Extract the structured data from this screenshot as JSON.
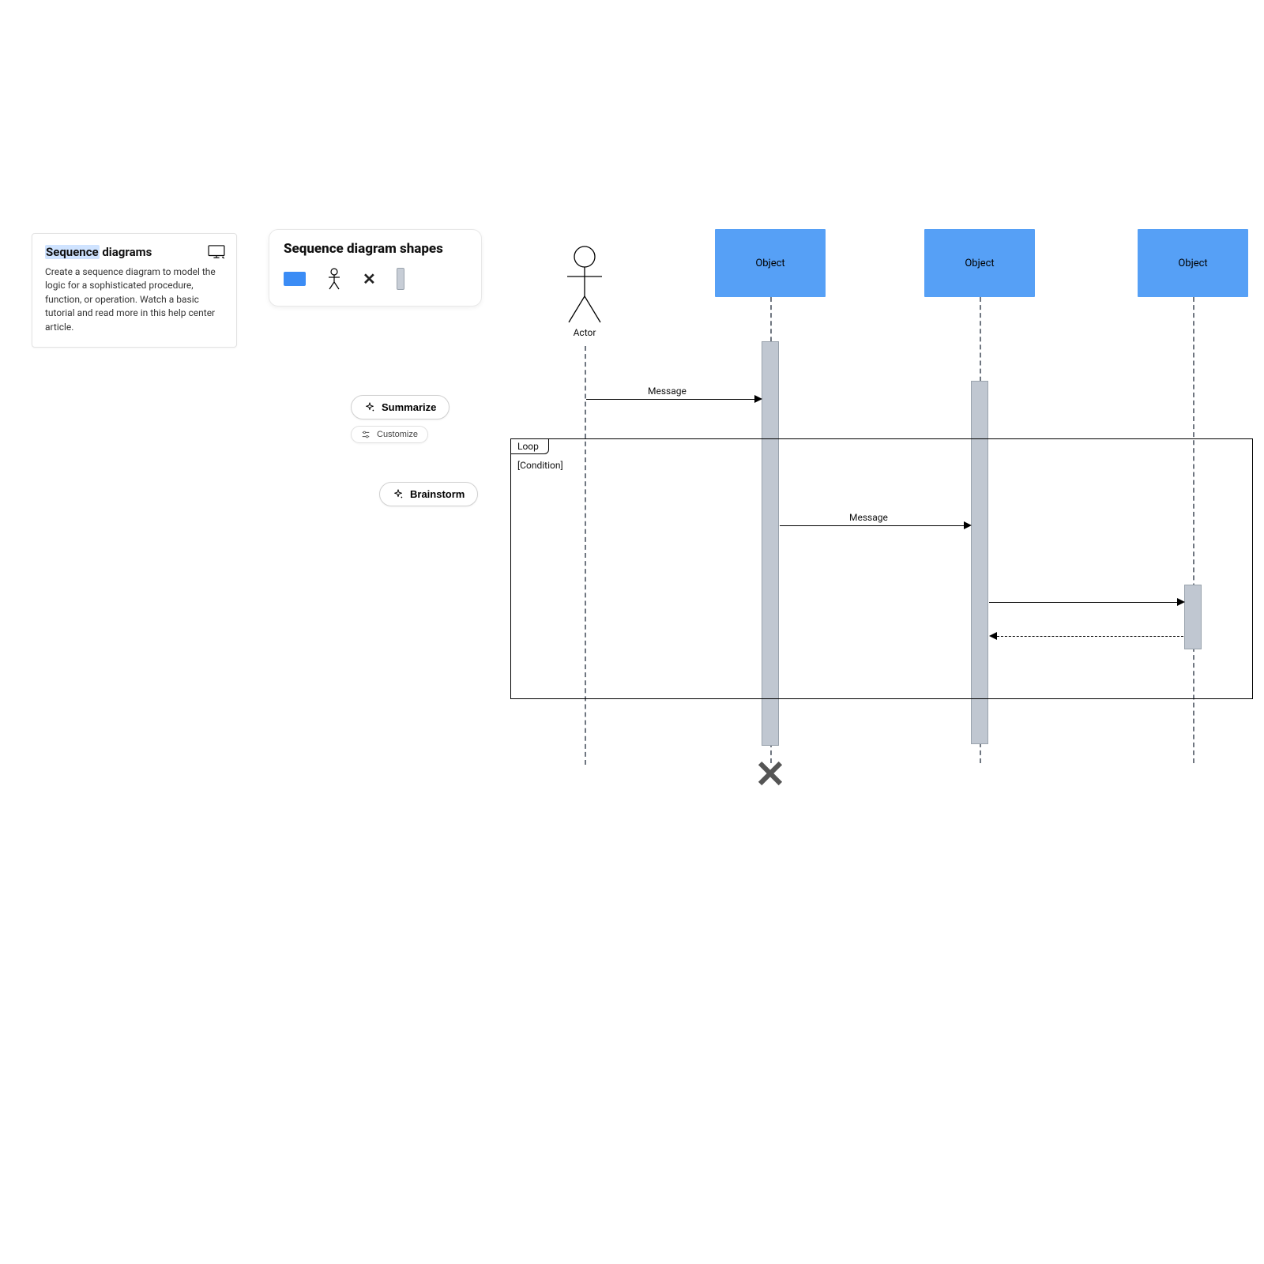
{
  "info": {
    "title_hl": "Sequence",
    "title_rest": " diagrams",
    "body": "Create a sequence diagram to model the logic for a sophisticated procedure, function, or operation. Watch a basic tutorial and read more in this help center article."
  },
  "palette": {
    "title": "Sequence diagram shapes"
  },
  "actions": {
    "summarize": "Summarize",
    "customize": "Customize",
    "brainstorm": "Brainstorm"
  },
  "diagram": {
    "actor_label": "Actor",
    "object_label": "Object",
    "msg1": "Message",
    "msg2": "Message",
    "loop_label": "Loop",
    "loop_condition": "[Condition]"
  },
  "colors": {
    "object": "#56a0f6",
    "activation": "#c0c7d1"
  }
}
